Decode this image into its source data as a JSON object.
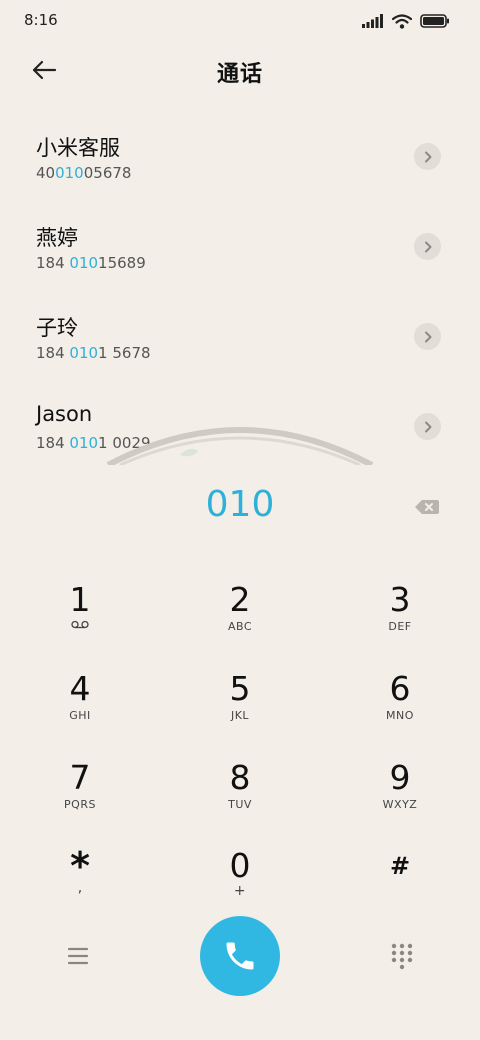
{
  "status_bar": {
    "time": "8:16"
  },
  "header": {
    "title": "通话"
  },
  "contacts": [
    {
      "name": "小米客服",
      "num_pre": "40",
      "num_hl": "010",
      "num_post": "05678"
    },
    {
      "name": "燕婷",
      "num_pre": "184 ",
      "num_hl": "010",
      "num_post": "15689"
    },
    {
      "name": "子玲",
      "num_pre": "184 ",
      "num_hl": "010",
      "num_post": "1 5678"
    },
    {
      "name": "Jason",
      "num_pre": "184 ",
      "num_hl": "010",
      "num_post": "1 0029"
    }
  ],
  "dialer": {
    "input": "010"
  },
  "keys": [
    {
      "digit": "1",
      "letters": ""
    },
    {
      "digit": "2",
      "letters": "ABC"
    },
    {
      "digit": "3",
      "letters": "DEF"
    },
    {
      "digit": "4",
      "letters": "GHI"
    },
    {
      "digit": "5",
      "letters": "JKL"
    },
    {
      "digit": "6",
      "letters": "MNO"
    },
    {
      "digit": "7",
      "letters": "PQRS"
    },
    {
      "digit": "8",
      "letters": "TUV"
    },
    {
      "digit": "9",
      "letters": "WXYZ"
    },
    {
      "digit": "*",
      "letters": ","
    },
    {
      "digit": "0",
      "letters": "+"
    },
    {
      "digit": "#",
      "letters": ""
    }
  ],
  "icons": {
    "back": "arrow-left-icon",
    "signal": "signal-icon",
    "wifi": "wifi-icon",
    "battery": "battery-icon",
    "chevron": "chevron-right-icon",
    "backspace": "backspace-icon",
    "voicemail": "voicemail-icon",
    "menu": "menu-icon",
    "call": "phone-icon",
    "grid": "dialpad-grid-icon"
  },
  "colors": {
    "accent": "#2fb0d8",
    "call_button": "#30b8e2",
    "background": "#f3efe8"
  }
}
